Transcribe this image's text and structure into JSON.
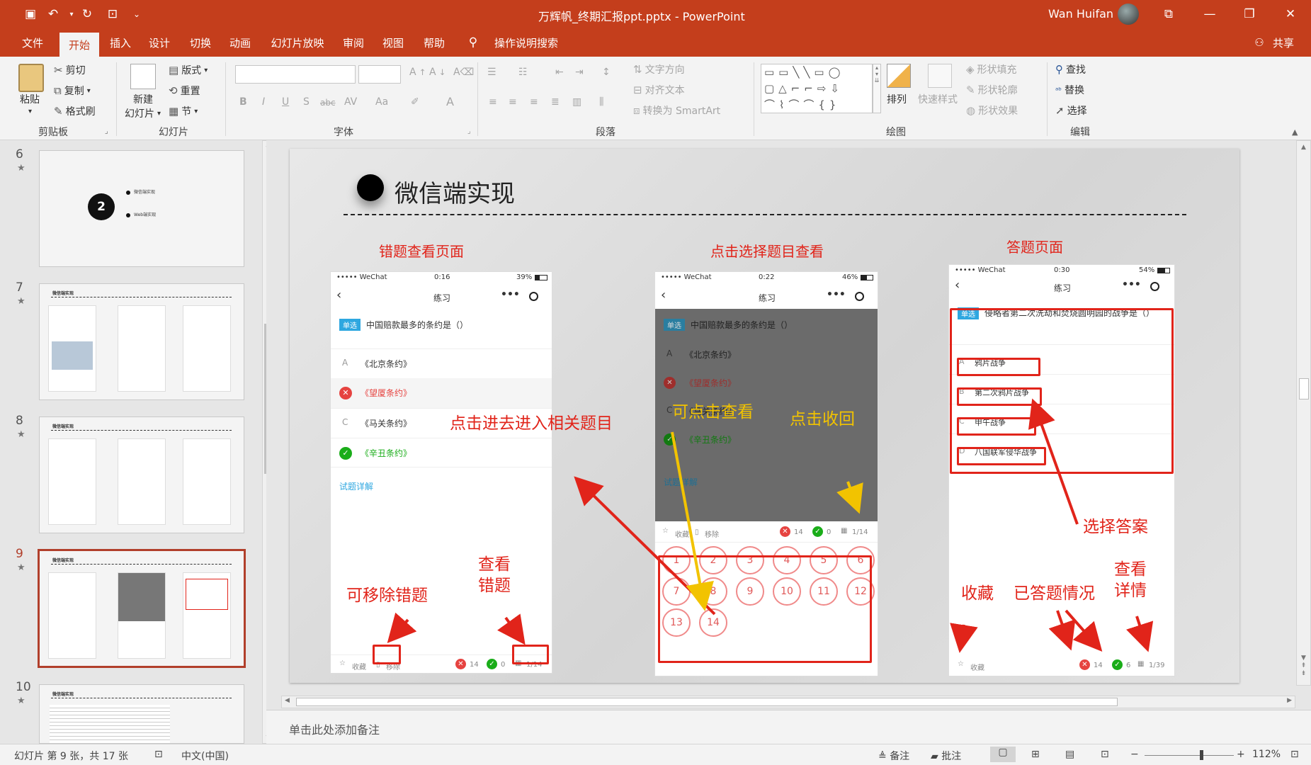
{
  "window": {
    "title": "万辉帆_终期汇报ppt.pptx  -  PowerPoint",
    "user": "Wan Huifan"
  },
  "tabs": [
    "文件",
    "开始",
    "插入",
    "设计",
    "切换",
    "动画",
    "幻灯片放映",
    "审阅",
    "视图",
    "帮助"
  ],
  "active_tab": "开始",
  "search_label": "操作说明搜索",
  "share_label": "共享",
  "ribbon": {
    "clipboard": {
      "paste": "粘贴",
      "cut": "剪切",
      "copy": "复制",
      "format_painter": "格式刷",
      "label": "剪贴板"
    },
    "slides": {
      "new_slide_1": "新建",
      "new_slide_2": "幻灯片",
      "layout": "版式",
      "reset": "重置",
      "section": "节",
      "label": "幻灯片"
    },
    "font": {
      "label": "字体",
      "bold": "B",
      "italic": "I",
      "underline": "U",
      "shadow": "S",
      "strike": "abc",
      "spacing": "AV",
      "case": "Aa",
      "color": "A"
    },
    "paragraph": {
      "label": "段落",
      "text_direction": "文字方向",
      "align_text": "对齐文本",
      "smartart": "转换为 SmartArt"
    },
    "drawing": {
      "label": "绘图",
      "arrange": "排列",
      "quick_styles": "快速样式",
      "fill": "形状填充",
      "outline": "形状轮廓",
      "effects": "形状效果"
    },
    "editing": {
      "label": "编辑",
      "find": "查找",
      "replace": "替换",
      "select": "选择"
    }
  },
  "thumbnails": [
    {
      "num": "6",
      "star": "★",
      "items": [
        "微信端实现",
        "Web端实现"
      ],
      "badge": "2"
    },
    {
      "num": "7",
      "star": "★",
      "title": "微信端实现"
    },
    {
      "num": "8",
      "star": "★",
      "title": "微信端实现"
    },
    {
      "num": "9",
      "star": "★",
      "title": "微信端实现"
    },
    {
      "num": "10",
      "star": "★",
      "title": "微信端实现"
    }
  ],
  "slide": {
    "title": "微信端实现",
    "section_labels": [
      "错题查看页面",
      "点击选择题目查看",
      "答题页面"
    ],
    "phone_common": {
      "carrier": "••••• WeChat",
      "page": "练习",
      "fav": "收藏",
      "remove": "移除"
    },
    "phone1": {
      "time": "0:16",
      "battery": "39%",
      "tag": "单选",
      "question": "中国赔款最多的条约是（）",
      "options": [
        {
          "letter": "A",
          "text": "《北京条约》",
          "state": "normal"
        },
        {
          "letter": "✕",
          "text": "《望厦条约》",
          "state": "wrong"
        },
        {
          "letter": "C",
          "text": "《马关条约》",
          "state": "normal"
        },
        {
          "letter": "✓",
          "text": "《辛丑条约》",
          "state": "right"
        }
      ],
      "detail": "试题详解",
      "wrong_count": "14",
      "right_count": "0",
      "progress": "1/14"
    },
    "phone2": {
      "time": "0:22",
      "battery": "46%",
      "tag": "单选",
      "question": "中国赔款最多的条约是（）",
      "options": [
        {
          "letter": "A",
          "text": "《北京条约》"
        },
        {
          "letter": "✕",
          "text": "《望厦条约》"
        },
        {
          "letter": "C",
          "text": "《马关条约》"
        },
        {
          "letter": "✓",
          "text": "《辛丑条约》"
        }
      ],
      "detail": "试题详解",
      "wrong_count": "14",
      "right_count": "0",
      "progress": "1/14",
      "numbers": [
        "1",
        "2",
        "3",
        "4",
        "5",
        "6",
        "7",
        "8",
        "9",
        "10",
        "11",
        "12",
        "13",
        "14"
      ]
    },
    "phone3": {
      "time": "0:30",
      "battery": "54%",
      "tag": "单选",
      "question": "侵略者第二次洗劫和焚烧圆明园的战争是（）",
      "options": [
        {
          "letter": "A",
          "text": "鸦片战争"
        },
        {
          "letter": "B",
          "text": "第二次鸦片战争"
        },
        {
          "letter": "C",
          "text": "甲午战争"
        },
        {
          "letter": "D",
          "text": "八国联军侵华战争"
        }
      ],
      "wrong_count": "14",
      "right_count": "6",
      "progress": "1/39"
    },
    "annotations": {
      "enter_topic": "点击进去进入相关题目",
      "removable": "可移除错题",
      "view_wrong_1": "查看",
      "view_wrong_2": "错题",
      "click_view": "可点击查看",
      "click_collapse": "点击收回",
      "choose_answer": "选择答案",
      "favorite": "收藏",
      "answered": "已答题情况",
      "view_detail_1": "查看",
      "view_detail_2": "详情"
    }
  },
  "notes_placeholder": "单击此处添加备注",
  "status": {
    "slide_info": "幻灯片 第 9 张，共 17 张",
    "language": "中文(中国)",
    "notes": "备注",
    "comments": "批注",
    "zoom": "112%",
    "zoom_level": 0.62
  },
  "colors": {
    "accent": "#c43e1c",
    "annotation_red": "#e1241a",
    "annotation_yellow": "#f2c300",
    "wechat_green": "#1aad19",
    "tag_blue": "#2ea7e0"
  }
}
